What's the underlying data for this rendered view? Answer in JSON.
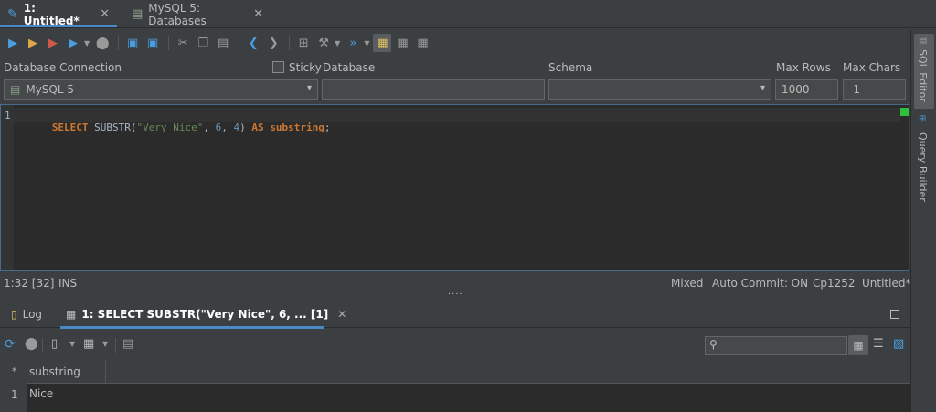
{
  "tabs": [
    {
      "label": "1: Untitled*",
      "active": true,
      "icon": "sql-file-icon"
    },
    {
      "label": "MySQL 5: Databases",
      "active": false,
      "icon": "database-icon"
    }
  ],
  "connection": {
    "database_connection_label": "Database Connection",
    "sticky_label": "Sticky",
    "database_label": "Database",
    "schema_label": "Schema",
    "max_rows_label": "Max Rows",
    "max_chars_label": "Max Chars",
    "connection_value": "MySQL 5",
    "database_value": "",
    "schema_value": "",
    "max_rows_value": "1000",
    "max_chars_value": "-1"
  },
  "editor": {
    "line_number": "1",
    "sql": {
      "select": "SELECT",
      "func": " SUBSTR(",
      "str": "\"Very Nice\"",
      "comma1": ", ",
      "n1": "6",
      "comma2": ", ",
      "n2": "4",
      "close": ") ",
      "as": "AS",
      "alias": " substring",
      "semi": ";"
    }
  },
  "side_tabs": {
    "sql_editor": "SQL Editor",
    "query_builder": "Query Builder"
  },
  "status": {
    "position": "1:32 [32]",
    "mode": "INS",
    "mixed": "Mixed",
    "auto_commit": "Auto Commit: ON",
    "encoding": "Cp1252",
    "file": "Untitled*",
    "splitter": "...."
  },
  "result_tabs": [
    {
      "label": "Log",
      "icon": "log-icon",
      "active": false
    },
    {
      "label": "1: SELECT SUBSTR(\"Very Nice\", 6, ... [1]",
      "icon": "grid-icon",
      "active": true
    }
  ],
  "result_search": {
    "placeholder": ""
  },
  "grid": {
    "row_marker_header": "*",
    "columns": [
      "substring"
    ],
    "rows": [
      {
        "num": "1",
        "values": [
          "Nice"
        ]
      }
    ]
  },
  "colors": {
    "accent": "#4a88c7",
    "keyword": "#cc7832",
    "string": "#6a8759",
    "number": "#6897bb",
    "background": "#3c3f41",
    "editor_bg": "#2b2b2b"
  }
}
